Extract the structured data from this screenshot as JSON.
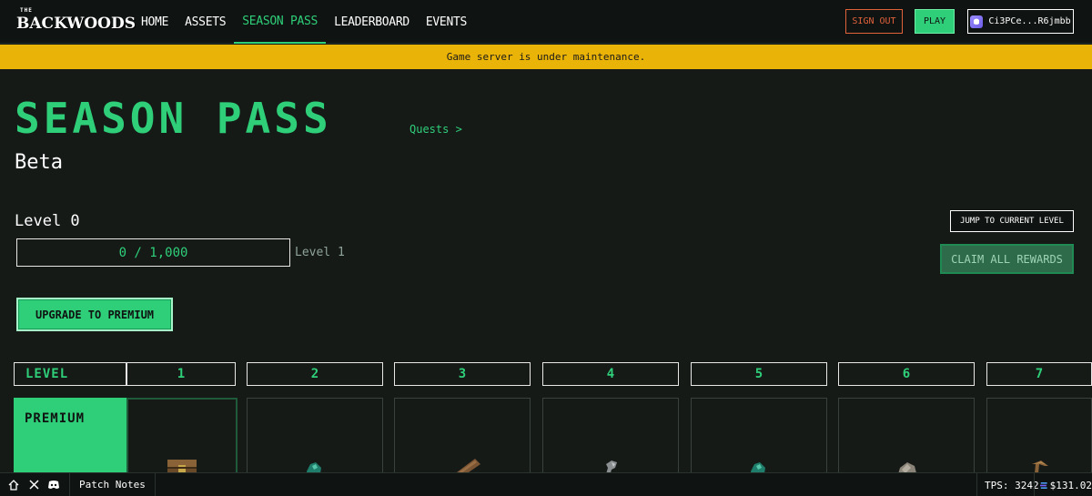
{
  "nav": {
    "logo_small": "THE",
    "logo_name": "BACKWOODS",
    "links": [
      "HOME",
      "ASSETS",
      "SEASON PASS",
      "LEADERBOARD",
      "EVENTS"
    ],
    "active_index": 2,
    "sign_out": "SIGN OUT",
    "play": "PLAY",
    "wallet": "Ci3PCe...R6jmbb"
  },
  "banner": {
    "text": "Game server is under maintenance."
  },
  "header": {
    "title": "SEASON PASS",
    "quests_link": "Quests >",
    "subtitle": "Beta"
  },
  "progress": {
    "level_label": "Level 0",
    "value_text": "0 / 1,000",
    "fraction": 0,
    "next_level": "Level 1"
  },
  "actions": {
    "jump": "JUMP TO CURRENT LEVEL",
    "claim_all": "CLAIM ALL REWARDS",
    "upgrade": "UPGRADE TO PREMIUM"
  },
  "track": {
    "level_header": "LEVEL",
    "premium_header": "PREMIUM",
    "levels": [
      "1",
      "2",
      "3",
      "4",
      "5",
      "6",
      "7"
    ]
  },
  "footer": {
    "patch_notes": "Patch Notes",
    "tps": "TPS: 3242",
    "price": "$131.02"
  },
  "colors": {
    "accent": "#2fcf7a",
    "banner": "#eab308",
    "sign_out": "#e0623b",
    "background": "#151a17"
  }
}
